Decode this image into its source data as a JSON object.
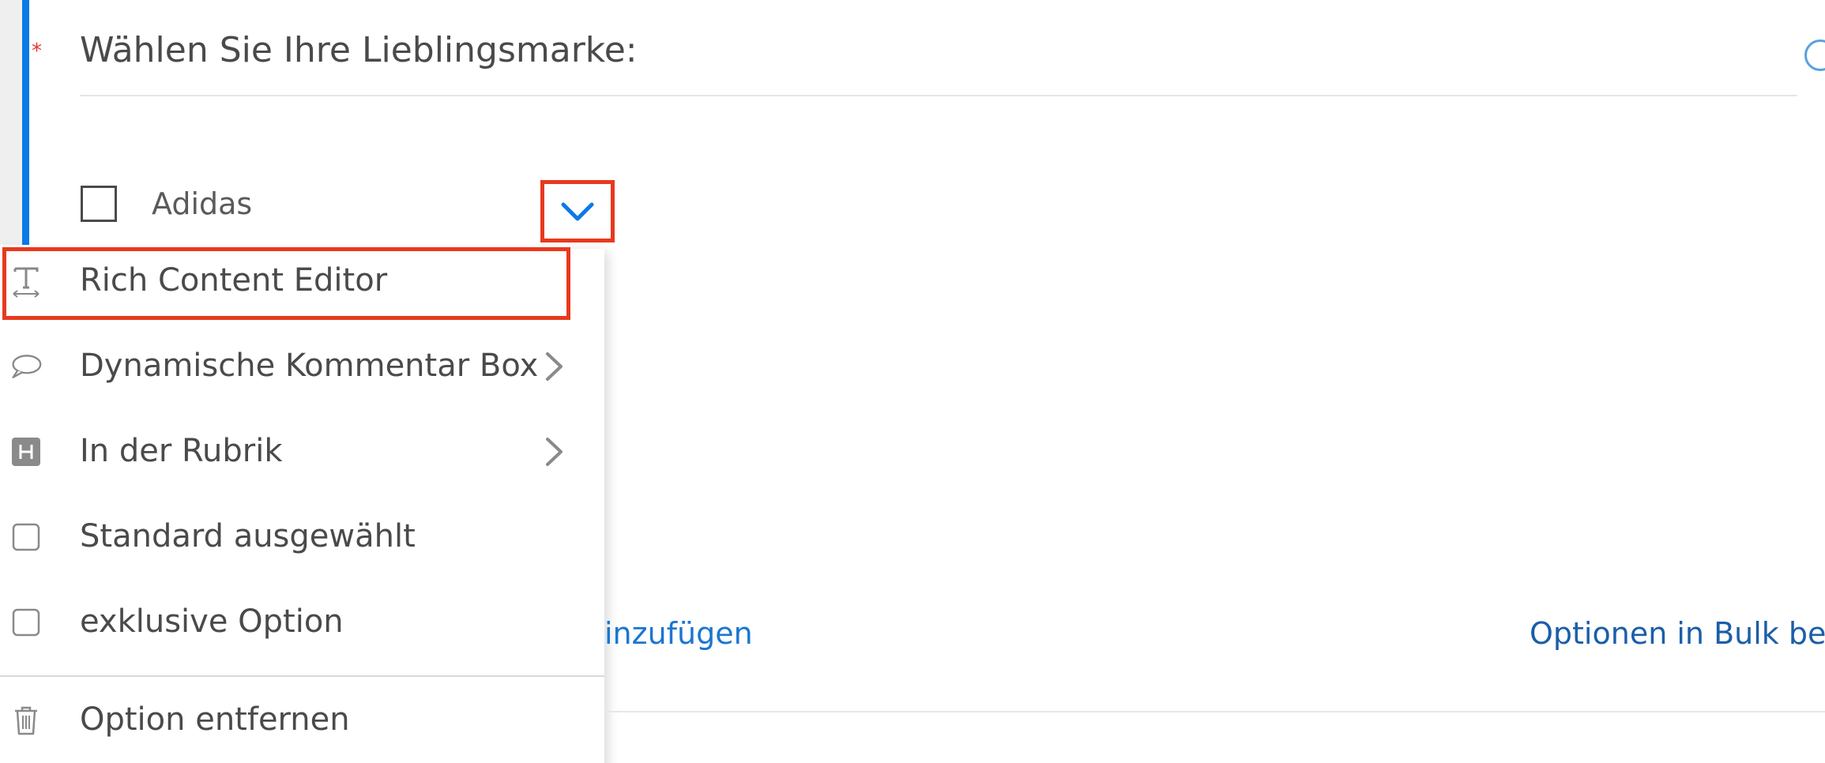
{
  "question": {
    "required_marker": "*",
    "title": "Wählen Sie Ihre Lieblingsmarke:"
  },
  "option": {
    "label": "Adidas"
  },
  "menu": {
    "items": [
      {
        "label": "Rich Content Editor",
        "icon": "text-format-icon",
        "has_submenu": false
      },
      {
        "label": "Dynamische Kommentar Box",
        "icon": "speech-bubble-icon",
        "has_submenu": true
      },
      {
        "label": "In der Rubrik",
        "icon": "heading-h-icon",
        "has_submenu": true
      },
      {
        "label": "Standard ausgewählt",
        "icon": "checkbox-icon",
        "has_submenu": false
      },
      {
        "label": "exklusive Option",
        "icon": "checkbox-icon",
        "has_submenu": false
      },
      {
        "label": "Option entfernen",
        "icon": "trash-icon",
        "has_submenu": false
      }
    ]
  },
  "links": {
    "add_option": "inzufügen",
    "bulk_edit": "Optionen in Bulk bea"
  },
  "colors": {
    "accent": "#0a7ae8",
    "highlight": "#e8391e",
    "link": "#1b76d1",
    "required": "#e4352c"
  }
}
